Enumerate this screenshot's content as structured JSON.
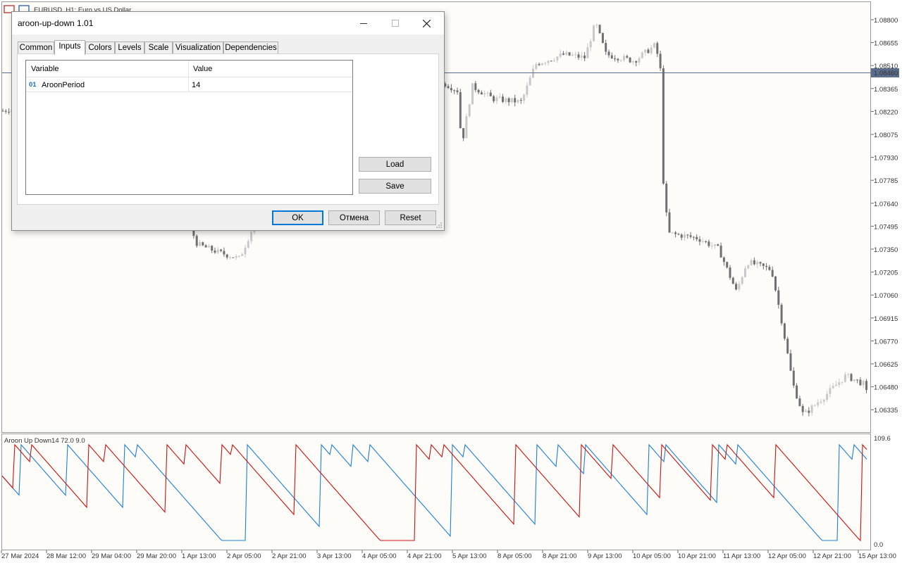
{
  "window": {
    "chart_tab_title": "EURUSD, H1:  Euro vs US Dollar"
  },
  "chart": {
    "price_labels": [
      "1.08800",
      "1.08655",
      "1.08510",
      "1.08365",
      "1.08220",
      "1.08075",
      "1.07930",
      "1.07785",
      "1.07640",
      "1.07495",
      "1.07350",
      "1.07205",
      "1.07060",
      "1.06915",
      "1.06770",
      "1.06625",
      "1.06480",
      "1.06335"
    ],
    "current_price": "1.08460",
    "time_labels": [
      "27 Mar 2024",
      "28 Mar 12:00",
      "29 Mar 04:00",
      "29 Mar 20:00",
      "1 Apr 13:00",
      "2 Apr 05:00",
      "2 Apr 21:00",
      "3 Apr 13:00",
      "4 Apr 05:00",
      "4 Apr 21:00",
      "5 Apr 13:00",
      "8 Apr 05:00",
      "8 Apr 21:00",
      "9 Apr 13:00",
      "10 Apr 05:00",
      "10 Apr 21:00",
      "11 Apr 13:00",
      "12 Apr 05:00",
      "12 Apr 21:00",
      "15 Apr 13:00"
    ],
    "indicator_label": "Aroon Up Down14 72.0 9.0",
    "indicator_max": "109.6",
    "indicator_min": "0.0",
    "colors": {
      "bull": "#c8c8c8",
      "bear": "#707070",
      "aroon_up": "#cc1111",
      "aroon_down": "#1f7fd4",
      "price_line": "#5a6e8c",
      "price_tag": "#5a6e8c"
    }
  },
  "dialog": {
    "title": "aroon-up-down 1.01",
    "controls": {
      "minimize": "minimize-icon",
      "maximize": "maximize-icon",
      "close": "close-icon"
    },
    "tabs": [
      {
        "label": "Common"
      },
      {
        "label": "Inputs"
      },
      {
        "label": "Colors"
      },
      {
        "label": "Levels"
      },
      {
        "label": "Scale"
      },
      {
        "label": "Visualization"
      },
      {
        "label": "Dependencies"
      }
    ],
    "active_tab": "Inputs",
    "grid": {
      "headers": {
        "variable": "Variable",
        "value": "Value"
      },
      "rows": [
        {
          "type_icon": "01",
          "variable": "AroonPeriod",
          "value": "14"
        }
      ]
    },
    "side_buttons": {
      "load": "Load",
      "save": "Save"
    },
    "footer_buttons": {
      "ok": "OK",
      "cancel": "Отмена",
      "reset": "Reset"
    }
  }
}
